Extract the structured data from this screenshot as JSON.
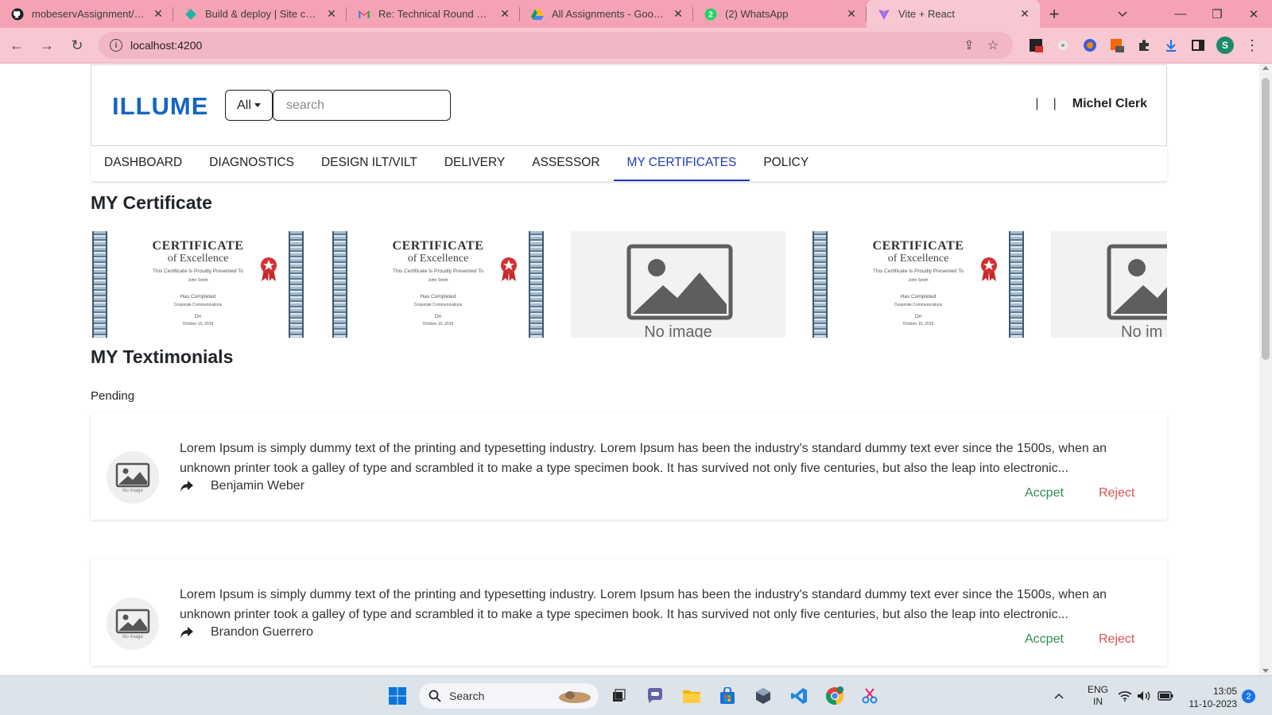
{
  "browser": {
    "tabs": [
      {
        "title": "mobeservAssignment/src/",
        "icon": "github-icon",
        "active": false
      },
      {
        "title": "Build & deploy | Site confi",
        "icon": "netlify-icon",
        "active": false
      },
      {
        "title": "Re: Technical Round Of Int",
        "icon": "gmail-icon",
        "active": false
      },
      {
        "title": "All Assignments - Google",
        "icon": "google-drive-icon",
        "active": false
      },
      {
        "title": "(2) WhatsApp",
        "icon": "whatsapp-icon",
        "active": false
      },
      {
        "title": "Vite + React",
        "icon": "vite-icon",
        "active": true
      }
    ],
    "url": "localhost:4200",
    "profile_initial": "S"
  },
  "app": {
    "brand": "ILLUME",
    "filter_label": "All",
    "search_placeholder": "search",
    "header_separator_1": "|",
    "header_separator_2": "|",
    "user_name": "Michel Clerk",
    "nav": [
      {
        "label": "DASHBOARD",
        "active": false
      },
      {
        "label": "DIAGNOSTICS",
        "active": false
      },
      {
        "label": "DESIGN ILT/VILT",
        "active": false
      },
      {
        "label": "DELIVERY",
        "active": false
      },
      {
        "label": "ASSESSOR",
        "active": false
      },
      {
        "label": "MY CERTIFICATES",
        "active": true
      },
      {
        "label": "POLICY",
        "active": false
      }
    ],
    "certificates_title": "MY Certificate",
    "certificate_template": {
      "title": "CERTIFICATE",
      "subtitle": "of Excellence",
      "presented": "This Certificate Is Proudly Presented To",
      "name": "John Smith",
      "completed": "Has Completed",
      "course": "Corporate Communications",
      "on": "On",
      "date": "October 10, 2019"
    },
    "certificates": [
      {
        "type": "certificate"
      },
      {
        "type": "certificate"
      },
      {
        "type": "no-image",
        "text": "No image"
      },
      {
        "type": "certificate"
      },
      {
        "type": "no-image",
        "text": "No im"
      }
    ],
    "testimonials_title": "MY Textimonials",
    "status_label": "Pending",
    "testimonials": [
      {
        "text": "Lorem Ipsum is simply dummy text of the printing and typesetting industry. Lorem Ipsum has been the industry's standard dummy text ever since the 1500s, when an unknown printer took a galley of type and scrambled it to make a type specimen book. It has survived not only five centuries, but also the leap into electronic...",
        "author": "Benjamin Weber",
        "avatar_text": "No image",
        "accept_label": "Accpet",
        "reject_label": "Reject"
      },
      {
        "text": "Lorem Ipsum is simply dummy text of the printing and typesetting industry. Lorem Ipsum has been the industry's standard dummy text ever since the 1500s, when an unknown printer took a galley of type and scrambled it to make a type specimen book. It has survived not only five centuries, but also the leap into electronic...",
        "author": "Brandon Guerrero",
        "avatar_text": "No image",
        "accept_label": "Accpet",
        "reject_label": "Reject"
      }
    ]
  },
  "taskbar": {
    "search_label": "Search",
    "language": "ENG",
    "region": "IN",
    "time": "13:05",
    "date": "11-10-2023",
    "notification_count": "2",
    "pinned": [
      "windows-start-icon",
      "file-explorer-icon",
      "teams-chat-icon",
      "folder-icon",
      "microsoft-store-icon",
      "virtualbox-icon",
      "vscode-icon",
      "chrome-icon",
      "snipping-tool-icon"
    ]
  },
  "colors": {
    "brand": "#1565c0",
    "nav_active": "#1e3ab8",
    "accept": "#2e8b57",
    "reject": "#d9534f",
    "tabstrip": "#f5a3b4"
  }
}
